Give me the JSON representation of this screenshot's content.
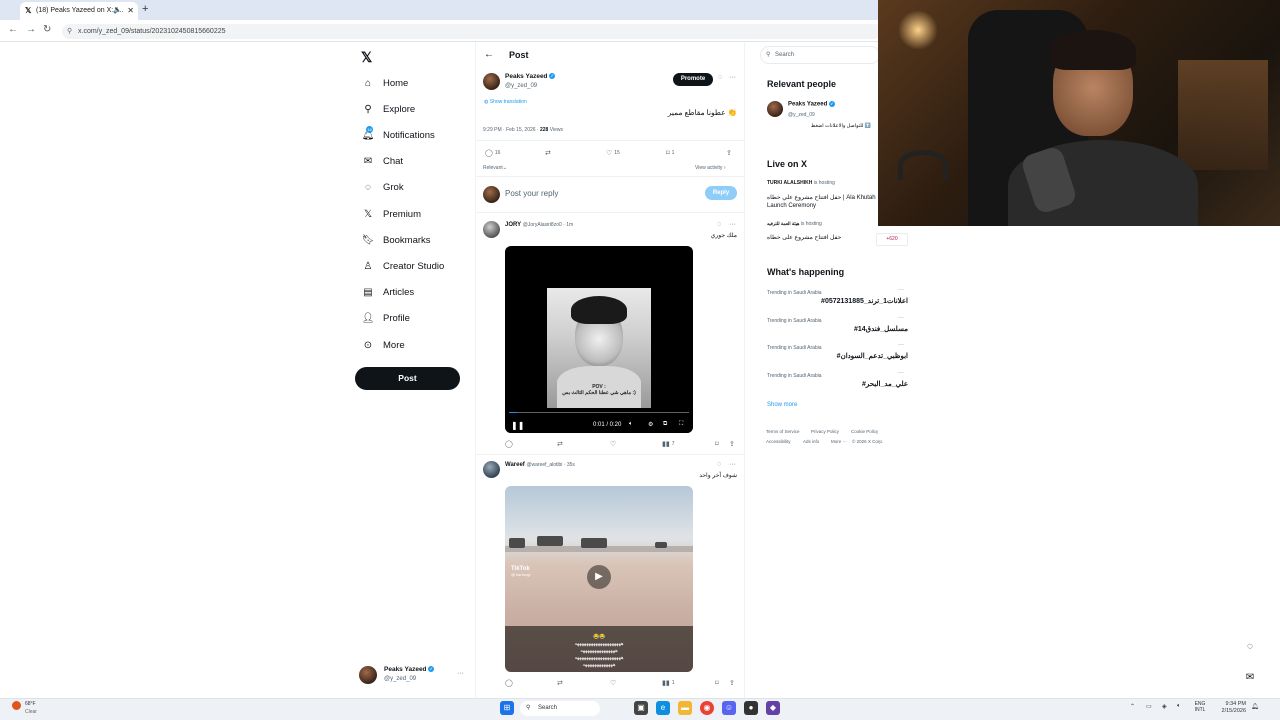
{
  "browser": {
    "tab_title": "(18) Peaks Yazeed on X: \"...",
    "url": "x.com/y_zed_09/status/2023102450815660225"
  },
  "sidebar": {
    "items": [
      {
        "label": "Home",
        "icon": "home-icon"
      },
      {
        "label": "Explore",
        "icon": "search-icon"
      },
      {
        "label": "Notifications",
        "icon": "bell-icon"
      },
      {
        "label": "Chat",
        "icon": "mail-icon"
      },
      {
        "label": "Grok",
        "icon": "grok-icon"
      },
      {
        "label": "Premium",
        "icon": "x-icon"
      },
      {
        "label": "Bookmarks",
        "icon": "bookmark-icon"
      },
      {
        "label": "Creator Studio",
        "icon": "creator-icon"
      },
      {
        "label": "Articles",
        "icon": "article-icon"
      },
      {
        "label": "Profile",
        "icon": "person-icon"
      },
      {
        "label": "More",
        "icon": "more-icon"
      }
    ],
    "notification_badge": "18",
    "post_button": "Post",
    "me": {
      "name": "Peaks Yazeed",
      "handle": "@y_zed_09"
    }
  },
  "header": {
    "title": "Post"
  },
  "post": {
    "author": "Peaks Yazeed",
    "handle": "@y_zed_09",
    "promote": "Promote",
    "text": "عطونا مقاطع ممير 👏",
    "show_translation": "Show translation",
    "timestamp": "9:29 PM · Feb 15, 2026 ·",
    "views_count": "228",
    "views_label": "Views",
    "replies": "16",
    "likes": "15",
    "bookmarks": "1",
    "sort": "Relevant",
    "view_activity": "View activity"
  },
  "reply_box": {
    "placeholder": "Post your reply",
    "button": "Reply"
  },
  "replies": [
    {
      "author": "JORY",
      "handle": "@JoryAlasiri8zo0 · 1m",
      "text": "ملك جوري",
      "video": {
        "time": "0:01 / 0:20",
        "pov": "POV :",
        "overlay_line": "ماهي شي عطنا الحكم الثالث بس :)",
        "progress": 0.05
      },
      "views": "7"
    },
    {
      "author": "Wareef",
      "handle": "@wareef_alotibi · 35s",
      "text": "شوف أخر واحد",
      "video": {
        "tiktok": "TikTok",
        "tiktok_handle": "@ kartoogi",
        "emojis": "😂😂",
        "caption_lines": [
          "ههههههههههههههههههههه",
          "هههههههههههههههه",
          "ههههههههههههههههههههه",
          "هههههههههههههه"
        ]
      },
      "views": "1"
    }
  ],
  "right": {
    "search_placeholder": "Search",
    "relevant_heading": "Relevant people",
    "relevant_person": {
      "name": "Peaks Yazeed",
      "handle": "@y_zed_09",
      "bio": "للتواصل والاعلانات اضغط ⬆️"
    },
    "live_heading": "Live on X",
    "live": [
      {
        "host": "TURKI ALALSHIKH",
        "status": "is hosting",
        "title": "حفل افتتاح مشروع علي خطاه | Ala Khutah Launch Ceremony"
      },
      {
        "host": "هيئة العمة للترفيه",
        "status": "is hosting",
        "title": "حفل افتتاح مشروع على خطاه",
        "count": "+620"
      }
    ],
    "happening_heading": "What's happening",
    "trends": [
      {
        "category": "Trending in Saudi Arabia",
        "tag": "#اعلانات1_ترند_0572131885"
      },
      {
        "category": "Trending in Saudi Arabia",
        "tag": "#مسلسل_فندق14"
      },
      {
        "category": "Trending in Saudi Arabia",
        "tag": "#ابوظبي_تدعم_السودان"
      },
      {
        "category": "Trending in Saudi Arabia",
        "tag": "#علي_مد_البحر"
      }
    ],
    "show_more": "Show more",
    "footer": [
      "Terms of Service",
      "Privacy Policy",
      "Cookie Policy",
      "Accessibility",
      "Ads info",
      "More ···",
      "© 2026 X Corp."
    ]
  },
  "taskbar": {
    "weather_temp": "68°F",
    "weather_desc": "Clear",
    "search": "Search",
    "lang": "ENG",
    "lang2": "INTL",
    "time": "9:34 PM",
    "date": "2/15/2026"
  }
}
